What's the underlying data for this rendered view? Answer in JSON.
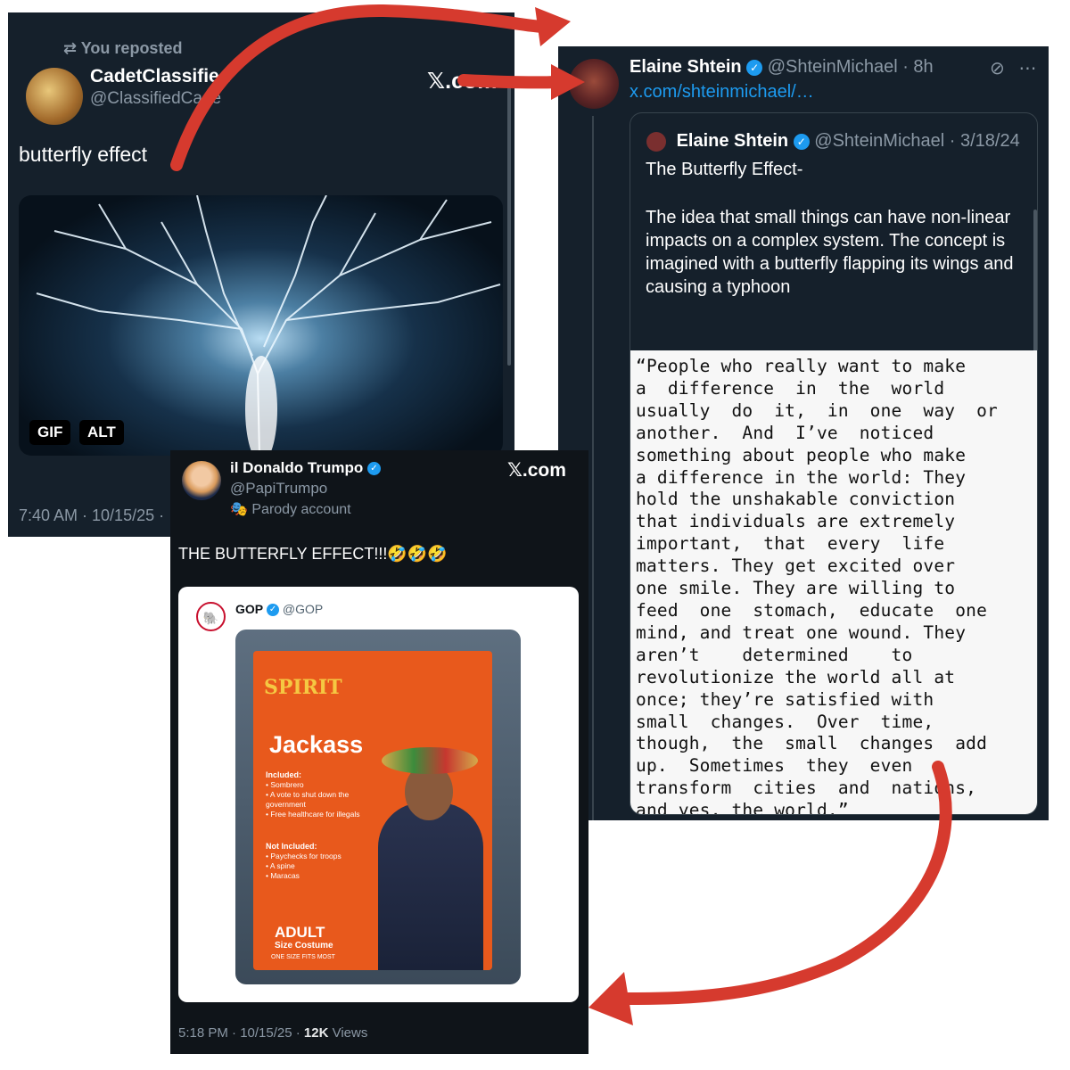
{
  "post1": {
    "repost_label": "You reposted",
    "name": "CadetClassified",
    "handle": "@ClassifiedCade",
    "site": "𝕏.com",
    "text": "butterfly effect",
    "media_badges": [
      "GIF",
      "ALT"
    ],
    "timestamp": "7:40 AM · 10/15/25 ·"
  },
  "post2": {
    "name": "Elaine Shtein",
    "handle_time": "@ShteinMichael · 8h",
    "link": "x.com/shteinmichael/…",
    "quote": {
      "name": "Elaine Shtein",
      "handle_time": "@ShteinMichael · 3/18/24",
      "title": "The Butterfly Effect-",
      "text": "The  idea that small things can have non-linear impacts on a complex system. The concept is imagined with a butterfly flapping its wings and causing a typhoon",
      "image_text": "“People who really want to make\na  difference  in  the  world\nusually  do  it,  in  one  way  or\nanother.  And  I’ve  noticed\nsomething about people who make\na difference in the world: They\nhold the unshakable conviction\nthat individuals are extremely\nimportant,  that  every  life\nmatters. They get excited over\none smile. They are willing to\nfeed  one  stomach,  educate  one\nmind, and treat one wound. They\naren’t    determined    to\nrevolutionize the world all at\nonce; they’re satisfied with\nsmall  changes.  Over  time,\nthough,  the  small  changes  add\nup.  Sometimes  they  even\ntransform  cities  and  nations,\nand yes, the world.”\n\n                 - Beth Clark"
    }
  },
  "post3": {
    "name": "il Donaldo Trumpo",
    "handle": "@PapiTrumpo",
    "parody_label": "Parody account",
    "site": "𝕏.com",
    "text": "THE BUTTERFLY EFFECT!!!🤣🤣🤣",
    "embed": {
      "name": "GOP",
      "handle": "@GOP",
      "costume": {
        "brand": "SPIRIT",
        "title": "Jackass",
        "included_label": "Included:",
        "included": [
          "Sombrero",
          "A vote to shut down the government",
          "Free healthcare for illegals"
        ],
        "not_included_label": "Not Included:",
        "not_included": [
          "Paychecks for troops",
          "A spine",
          "Maracas"
        ],
        "adult": "ADULT",
        "size": "Size Costume",
        "one_size": "ONE SIZE FITS MOST"
      }
    },
    "timestamp": "5:18 PM · 10/15/25 · ",
    "views_count": "12K",
    "views_label": " Views"
  },
  "colors": {
    "card_bg": "#15202b",
    "accent_blue": "#1d9bf0",
    "arrow_red": "#d63a2e"
  }
}
